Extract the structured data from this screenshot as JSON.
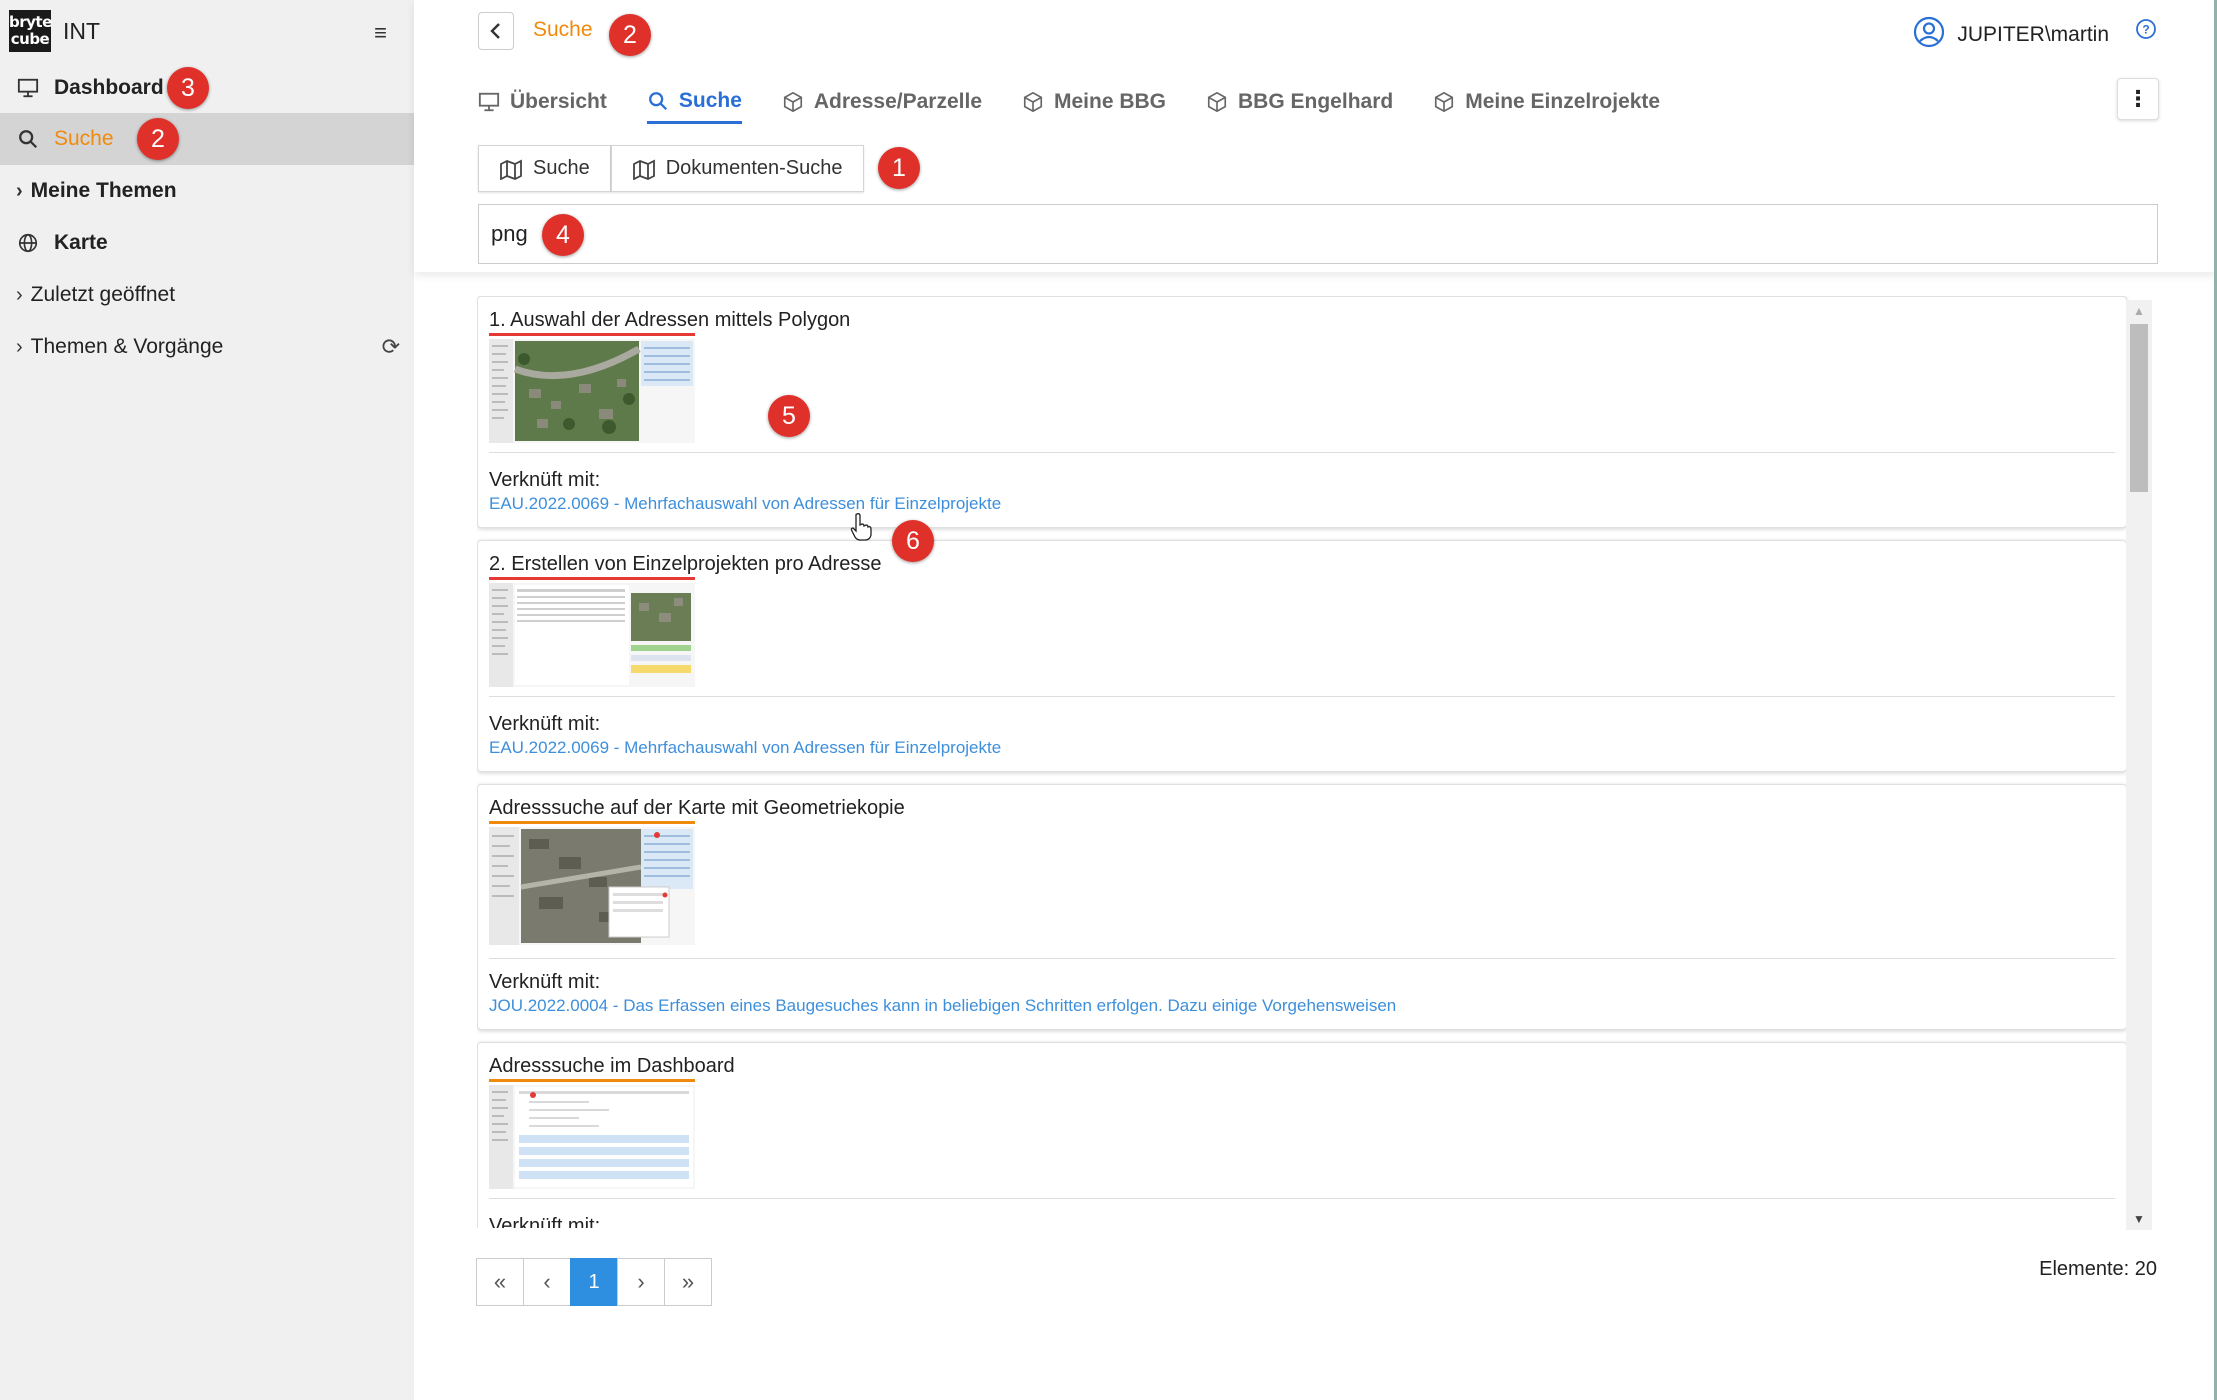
{
  "sidebar": {
    "app_name": "INT",
    "logo_text": "bryte cube",
    "items": [
      {
        "label": "Dashboard",
        "icon": "monitor-icon"
      },
      {
        "label": "Suche",
        "icon": "search-icon"
      },
      {
        "label": "Meine Themen",
        "icon": "chevron-right-icon"
      },
      {
        "label": "Karte",
        "icon": "globe-icon"
      },
      {
        "label": "Zuletzt geöffnet",
        "icon": "chevron-right-icon"
      },
      {
        "label": "Themen & Vorgänge",
        "icon": "chevron-right-icon"
      }
    ]
  },
  "header": {
    "title": "Suche",
    "user": "JUPITER\\martin",
    "tabs": [
      {
        "label": "Übersicht",
        "icon": "monitor-icon"
      },
      {
        "label": "Suche",
        "icon": "search-icon"
      },
      {
        "label": "Adresse/Parzelle",
        "icon": "cube-icon"
      },
      {
        "label": "Meine BBG",
        "icon": "cube-icon"
      },
      {
        "label": "BBG Engelhard",
        "icon": "cube-icon"
      },
      {
        "label": "Meine Einzelrojekte",
        "icon": "cube-icon"
      }
    ],
    "subtabs": [
      {
        "label": "Suche",
        "icon": "map-icon"
      },
      {
        "label": "Dokumenten-Suche",
        "icon": "map-icon"
      }
    ],
    "search_value": "png"
  },
  "results": [
    {
      "title": "1. Auswahl der Adressen mittels Polygon",
      "linked_label": "Verknüft mit:",
      "link": "EAU.2022.0069 - Mehrfachauswahl von Adressen für Einzelprojekte",
      "accent": "#e53935"
    },
    {
      "title": "2. Erstellen von Einzelprojekten pro Adresse",
      "linked_label": "Verknüft mit:",
      "link": "EAU.2022.0069 - Mehrfachauswahl von Adressen für Einzelprojekte",
      "accent": "#e53935"
    },
    {
      "title": "Adresssuche auf der Karte mit Geometriekopie",
      "linked_label": "Verknüft mit:",
      "link": "JOU.2022.0004 - Das Erfassen eines Baugesuches kann in beliebigen Schritten erfolgen. Dazu einige Vorgehensweisen",
      "accent": "#f08a0c"
    },
    {
      "title": "Adresssuche im Dashboard",
      "linked_label": "Verknüft mit:",
      "link": "",
      "accent": "#f08a0c"
    }
  ],
  "pagination": {
    "first": "«",
    "prev": "‹",
    "current": "1",
    "next": "›",
    "last": "»",
    "count_text": "Elemente: 20"
  },
  "badges": [
    "1",
    "2",
    "2",
    "3",
    "4",
    "5",
    "6"
  ],
  "colors": {
    "accent_orange": "#f08a0c",
    "active_blue": "#2a6fd6",
    "link_blue": "#3d8fdc",
    "badge_red": "#e0302a"
  }
}
